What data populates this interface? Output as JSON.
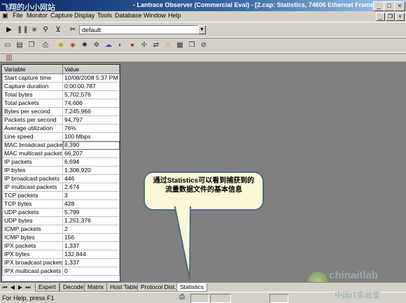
{
  "window": {
    "watermark_top": "飞翔的小小网站",
    "title": "- Lantrace Observer (Commercial Eval) - [2.cap: Statistics, 74606 Ethernet Frames]",
    "controls": [
      "_",
      "□",
      "×"
    ]
  },
  "menu": [
    "File",
    "Monitor",
    "Capture",
    "Display",
    "Tools",
    "Database",
    "Window",
    "Help"
  ],
  "toolbar": {
    "profile": "default",
    "icons1": [
      "play-icon",
      "pause-icon",
      "stop-icon",
      "binoculars-icon",
      "filter-icon",
      "tools-icon"
    ],
    "icons2": [
      "new-icon",
      "save-icon",
      "copy-icon",
      "print-icon",
      "smiley-icon",
      "chart-icon",
      "bomb-icon",
      "gear-icon",
      "cloud-icon",
      "globe-icon",
      "ball-icon",
      "nodes-icon",
      "arrows-icon",
      "warning-icon",
      "bars-icon",
      "book-icon",
      "no-icon"
    ],
    "icons3": [
      "stats-icon"
    ]
  },
  "stats": {
    "headers": [
      "Variable",
      "Value"
    ],
    "rows": [
      [
        "Start capture time",
        "10/08/2008 5:37 PM"
      ],
      [
        "Capture duration",
        "0:00:00.787"
      ],
      [
        "Total bytes",
        "5,702,576"
      ],
      [
        "Total packets",
        "74,606"
      ],
      [
        "Bytes per second",
        "7,245,966"
      ],
      [
        "Packets per second",
        "94,797"
      ],
      [
        "Average utilization",
        "76%"
      ],
      [
        "Line speed",
        "100 Mbps"
      ],
      [
        "MAC broadcast packets",
        "8,390"
      ],
      [
        "MAC multicast packets",
        "66,207"
      ],
      [
        "IP packets",
        "6,694"
      ],
      [
        "IP bytes",
        "1,308,920"
      ],
      [
        "IP broadcast packets",
        "446"
      ],
      [
        "IP multicast packets",
        "2,674"
      ],
      [
        "TCP packets",
        "3"
      ],
      [
        "TCP bytes",
        "428"
      ],
      [
        "UDP packets",
        "5,799"
      ],
      [
        "UDP bytes",
        "1,251,376"
      ],
      [
        "ICMP packets",
        "2"
      ],
      [
        "ICMP bytes",
        "156"
      ],
      [
        "IPX packets",
        "1,337"
      ],
      [
        "IPX bytes",
        "132,844"
      ],
      [
        "IPX broadcast packets",
        "1,337"
      ],
      [
        "IPX multicast packets",
        "0"
      ]
    ]
  },
  "callout": "通过Statistics可以看到捕获到的流量数据文件的基本信息",
  "tabs": [
    "Expert",
    "Decode",
    "Matrix",
    "Host Table",
    "Protocol Dist.",
    "Statistics"
  ],
  "active_tab": "Statistics",
  "status": "For Help, press F1",
  "watermark_logo": "chinaitlab",
  "watermark_logo_cn": "中国IT实验室",
  "colors": {
    "titlebar": "#0a246a",
    "callout_bg": "#fbf8d7",
    "callout_border": "#4a6a8a"
  }
}
